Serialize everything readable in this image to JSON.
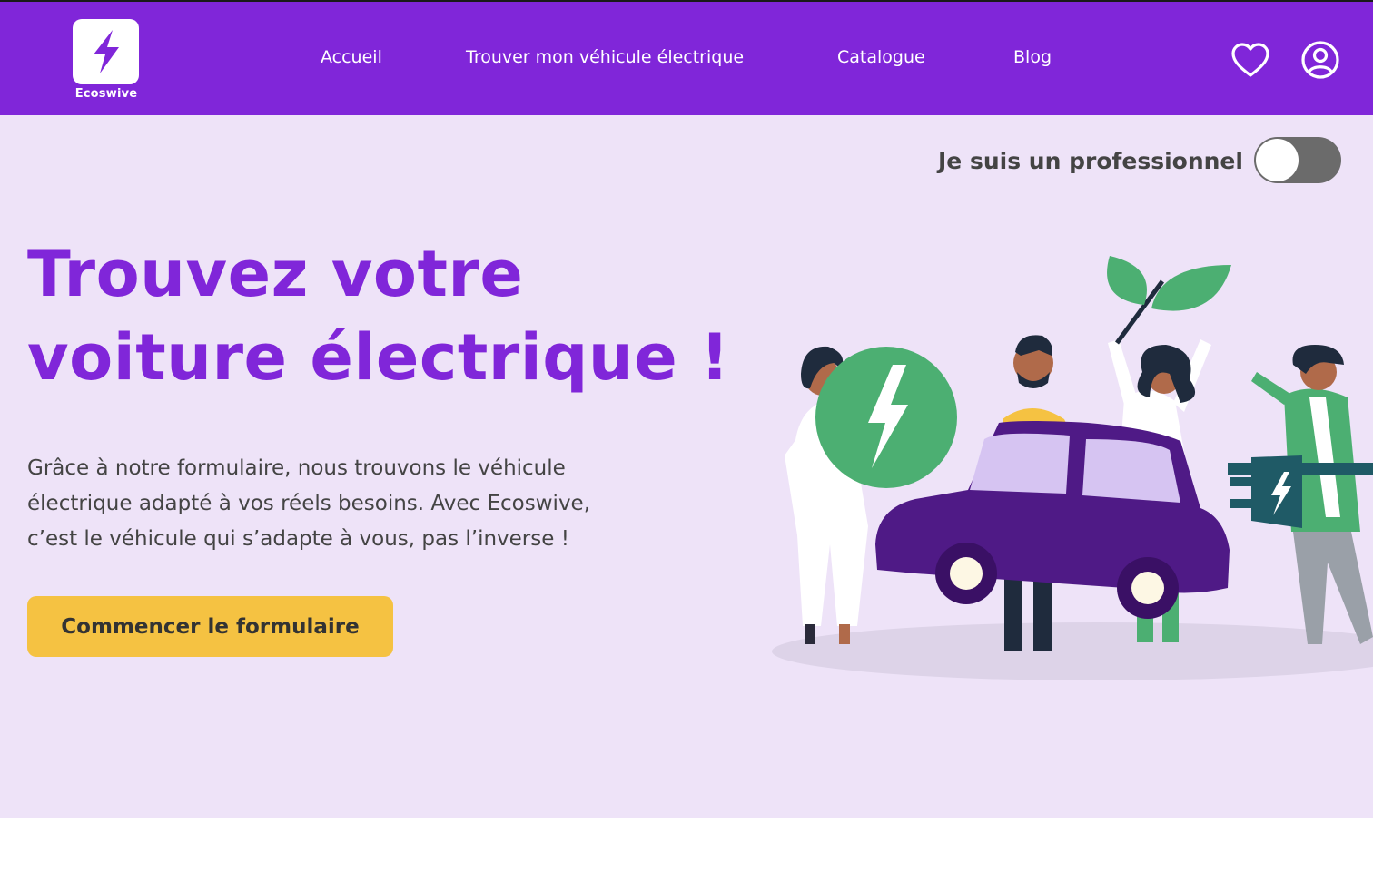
{
  "brand": {
    "name": "Ecoswive",
    "logo_icon": "lightning-bolt-icon"
  },
  "nav": {
    "items": [
      {
        "label": "Accueil"
      },
      {
        "label": "Trouver mon véhicule électrique"
      },
      {
        "label": "Catalogue"
      },
      {
        "label": "Blog"
      }
    ],
    "favorites_icon": "heart-icon",
    "account_icon": "user-circle-icon"
  },
  "pro_toggle": {
    "label": "Je suis un professionnel",
    "on": false
  },
  "hero": {
    "title_lines": [
      "Trouvez votre",
      "voiture électrique !"
    ],
    "text_lines": [
      "Grâce à notre formulaire, nous trouvons le véhicule",
      "électrique adapté à vos réels besoins. Avec Ecoswive,",
      "c’est le véhicule qui s’adapte à vous, pas l’inverse !"
    ],
    "cta_label": "Commencer le formulaire"
  },
  "colors": {
    "brand_purple": "#8026d9",
    "hero_background": "#eee3f8",
    "cta_yellow": "#f5c242",
    "toggle_off": "#6b6b6b",
    "car_purple": "#4f1a86",
    "energy_green": "#4caf72"
  }
}
